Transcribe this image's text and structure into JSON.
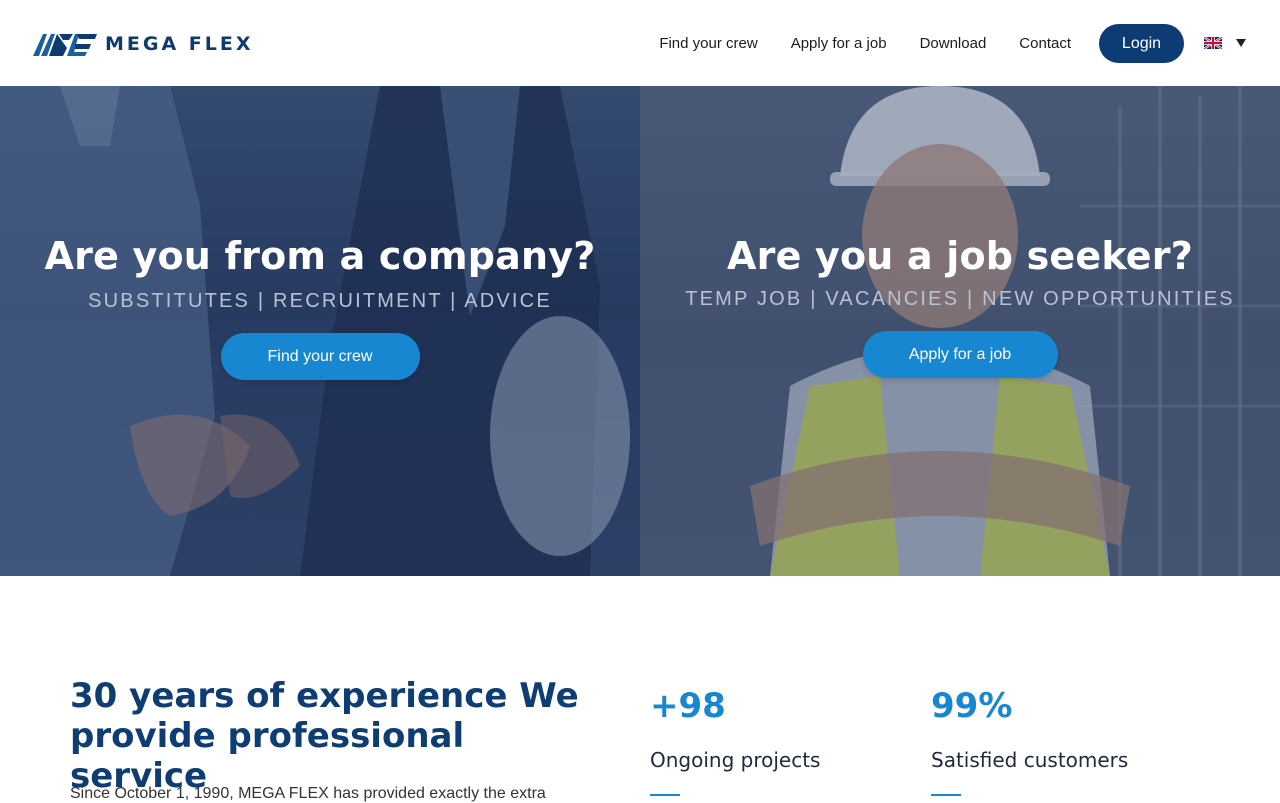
{
  "header": {
    "logo_text": "MEGA FLEX",
    "nav": [
      {
        "label": "Find your crew"
      },
      {
        "label": "Apply for a job"
      },
      {
        "label": "Download"
      },
      {
        "label": "Contact"
      }
    ],
    "login_label": "Login",
    "language_icon": "uk-flag-icon"
  },
  "hero": {
    "company": {
      "title": "Are you from a company?",
      "subtitle": "SUBSTITUTES | RECRUITMENT | ADVICE",
      "button_label": "Find your crew"
    },
    "jobseeker": {
      "title": "Are you a job seeker?",
      "subtitle": "TEMP JOB | VACANCIES | NEW OPPORTUNITIES",
      "button_label": "Apply for a job"
    }
  },
  "about": {
    "title": "30 years of experience We provide professional service",
    "text": "Since October 1, 1990, MEGA FLEX has provided exactly the extra"
  },
  "stats": [
    {
      "value": "+98",
      "label": "Ongoing projects"
    },
    {
      "value": "99%",
      "label": "Satisfied customers"
    }
  ],
  "colors": {
    "brand_dark": "#0c3c73",
    "accent": "#1687d0"
  }
}
